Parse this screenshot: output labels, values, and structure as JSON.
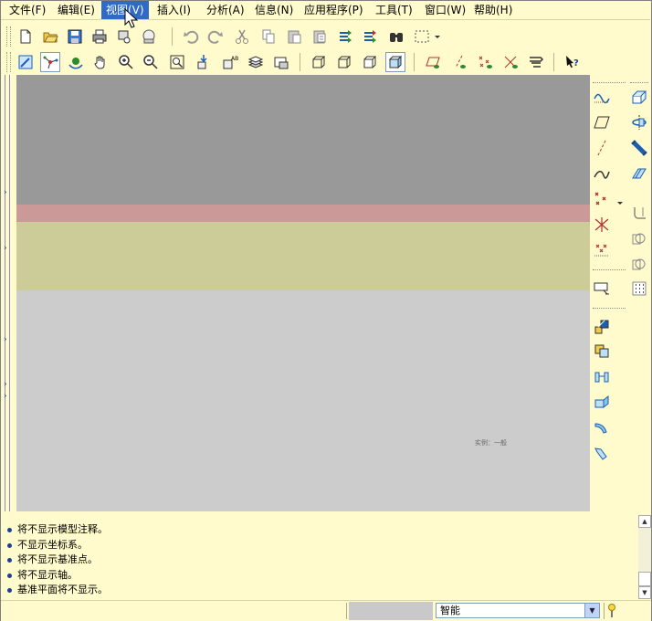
{
  "menu": {
    "items": [
      {
        "label": "文件(F)"
      },
      {
        "label": "编辑(E)"
      },
      {
        "label": "视图(V)"
      },
      {
        "label": "插入(I)"
      },
      {
        "label": "分析(A)"
      },
      {
        "label": "信息(N)"
      },
      {
        "label": "应用程序(P)"
      },
      {
        "label": "工具(T)"
      },
      {
        "label": "窗口(W)"
      },
      {
        "label": "帮助(H)"
      }
    ],
    "active_index": 2
  },
  "toolbar1": {
    "icons": [
      "new-file-icon",
      "open-folder-icon",
      "save-icon",
      "print-icon",
      "print-preview-icon",
      "plot-icon",
      "undo-icon",
      "redo-icon",
      "cut-icon",
      "copy-icon",
      "paste-icon",
      "paste-special-icon",
      "regenerate-icon",
      "regenerate-manager-icon",
      "find-icon",
      "select-box-icon"
    ]
  },
  "toolbar2": {
    "icons": [
      "repaint-icon",
      "spin-center-icon",
      "orient-mode-icon",
      "pan-icon",
      "zoom-in-icon",
      "zoom-out-icon",
      "refit-icon",
      "reorient-icon",
      "saved-views-icon",
      "layers-icon",
      "view-manager-icon",
      "wireframe-icon",
      "hidden-line-icon",
      "no-hidden-icon",
      "shading-icon",
      "datum-planes-icon",
      "datum-axes-icon",
      "datum-points-icon",
      "datum-csys-icon",
      "annotations-icon",
      "whats-this-icon"
    ]
  },
  "right_tools": {
    "icons": [
      "sketched-datum-curve-icon",
      "datum-plane-icon",
      "datum-axis-icon",
      "datum-curve-icon",
      "datum-point-icon",
      "sketched-point-icon",
      "offset-point-icon",
      "extrude-icon",
      "revolve-icon",
      "sweep-icon",
      "blend-icon",
      "round-icon",
      "chamfer-icon",
      "hole-icon",
      "shell-icon",
      "rib-icon",
      "draft-icon",
      "pattern-icon",
      "mirror-icon",
      "merge-icon",
      "trim-icon",
      "edit-definition-icon",
      "insert-mode-icon"
    ]
  },
  "viewport": {
    "watermark": "实例：一般",
    "bands": [
      {
        "color": "#999999"
      },
      {
        "color": "#cc9999"
      },
      {
        "color": "#cccc99"
      },
      {
        "color": "#cccccc"
      }
    ]
  },
  "messages": [
    "将不显示模型注释。",
    "不显示坐标系。",
    "将不显示基准点。",
    "将不显示轴。",
    "基准平面将不显示。"
  ],
  "status": {
    "filter_value": "智能"
  },
  "colors": {
    "background": "#fffbcc",
    "menu_active": "#316ac5"
  }
}
